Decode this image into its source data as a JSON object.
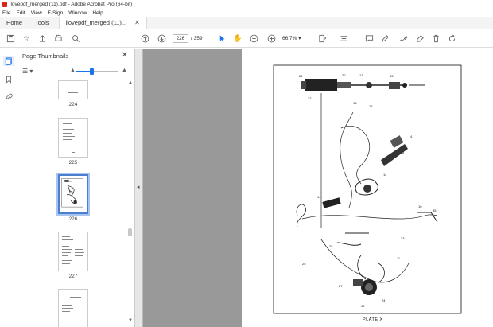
{
  "window": {
    "title": "ilovepdf_merged (11).pdf - Adobe Acrobat Pro (64-bit)"
  },
  "menu": [
    "File",
    "Edit",
    "View",
    "E-Sign",
    "Window",
    "Help"
  ],
  "tabs": {
    "home": "Home",
    "tools": "Tools",
    "doc": "ilovepdf_merged (11)..."
  },
  "nav": {
    "current_page": "226",
    "separator": "/",
    "total_pages": "359",
    "zoom": "66.7%"
  },
  "panel": {
    "title": "Page Thumbnails",
    "thumbnails": [
      {
        "label": "224"
      },
      {
        "label": "225"
      },
      {
        "label": "226"
      },
      {
        "label": "227"
      }
    ]
  },
  "document": {
    "plate_label": "PLATE X"
  },
  "colors": {
    "accent": "#1a73e8",
    "selection": "#4a7fd0",
    "doc_bg": "#999999"
  }
}
